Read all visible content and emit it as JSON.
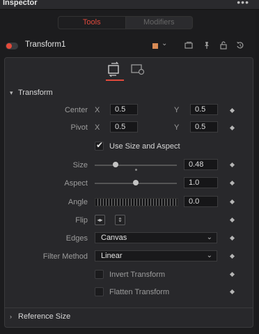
{
  "window": {
    "title": "Inspector",
    "menu_icon": "ellipsis-icon"
  },
  "tabs": [
    {
      "label": "Tools",
      "active": true
    },
    {
      "label": "Modifiers",
      "active": false
    }
  ],
  "tool": {
    "name": "Transform1",
    "enabled": true,
    "color": "#d88a55",
    "icons": [
      "versions-icon",
      "pin-icon",
      "lock-icon",
      "reset-icon"
    ]
  },
  "subtabs": [
    {
      "icon": "transform-controls-icon",
      "active": true
    },
    {
      "icon": "settings-controls-icon",
      "active": false
    }
  ],
  "sections": {
    "transform": {
      "label": "Transform",
      "expanded": true
    },
    "reference_size": {
      "label": "Reference Size",
      "expanded": false
    }
  },
  "controls": {
    "center": {
      "label": "Center",
      "x_label": "X",
      "x": "0.5",
      "y_label": "Y",
      "y": "0.5"
    },
    "pivot": {
      "label": "Pivot",
      "x_label": "X",
      "x": "0.5",
      "y_label": "Y",
      "y": "0.5"
    },
    "use_size_aspect": {
      "label": "Use Size and Aspect",
      "checked": true
    },
    "size": {
      "label": "Size",
      "value": "0.48",
      "slider_fraction": 0.24
    },
    "aspect": {
      "label": "Aspect",
      "value": "1.0",
      "slider_fraction": 0.5
    },
    "angle": {
      "label": "Angle",
      "value": "0.0"
    },
    "flip": {
      "label": "Flip",
      "h_icon": "flip-horizontal-icon",
      "v_icon": "flip-vertical-icon"
    },
    "edges": {
      "label": "Edges",
      "value": "Canvas"
    },
    "filter_method": {
      "label": "Filter Method",
      "value": "Linear"
    },
    "invert_transform": {
      "label": "Invert Transform",
      "checked": false
    },
    "flatten_transform": {
      "label": "Flatten Transform",
      "checked": false
    }
  },
  "colors": {
    "accent": "#e04a3c",
    "panel": "#28282b",
    "background": "#1c1c1e"
  }
}
